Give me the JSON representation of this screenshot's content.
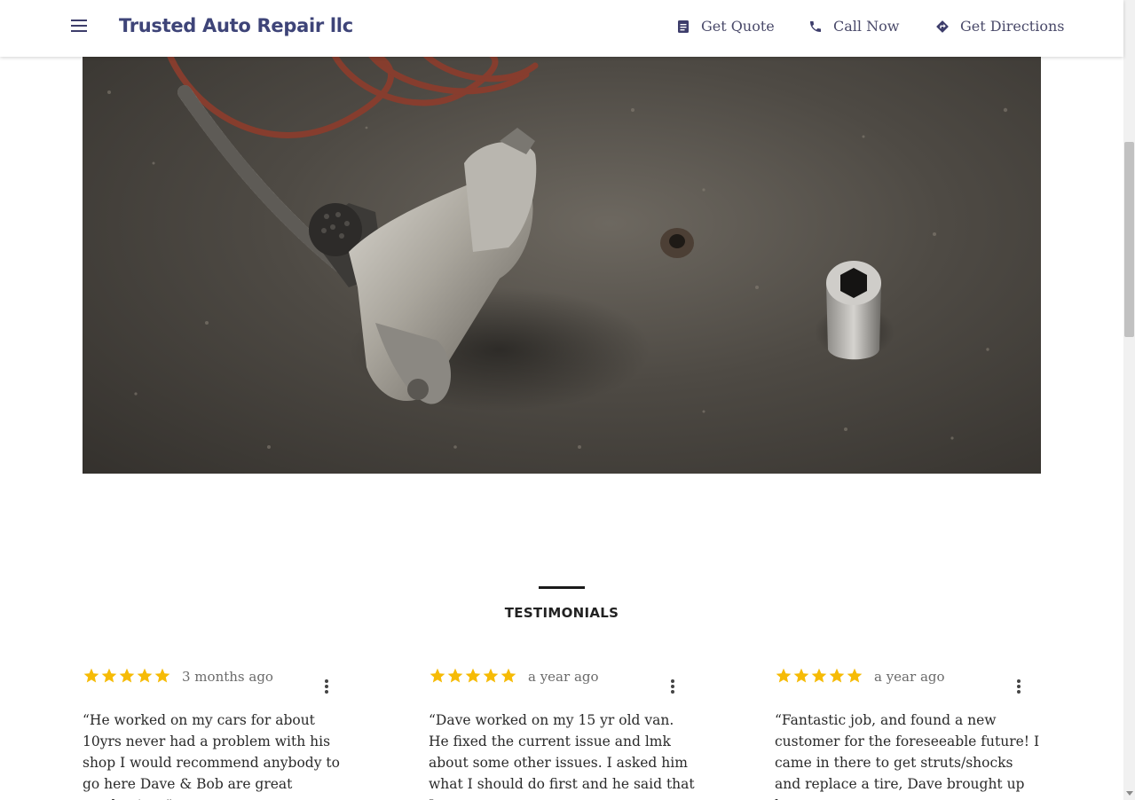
{
  "header": {
    "brand": "Trusted Auto Repair llc",
    "nav": {
      "quote": "Get Quote",
      "call": "Call Now",
      "directions": "Get Directions"
    }
  },
  "colors": {
    "brand": "#3e4478",
    "star": "#f6bb06",
    "text": "#212121"
  },
  "icons": {
    "menu": "menu-icon",
    "quote": "quote-doc-icon",
    "call": "phone-icon",
    "directions": "directions-icon",
    "star": "star-icon",
    "more": "more-vert-icon"
  },
  "hero": {
    "image": "impact wrench and sockets on concrete floor"
  },
  "testimonials": {
    "title": "TESTIMONIALS",
    "reviews": [
      {
        "rating": 5,
        "time": "3 months ago",
        "text": "“He worked on my cars for about 10yrs never had a problem with his shop I would recommend anybody to go here Dave & Bob are great mechanics..”"
      },
      {
        "rating": 5,
        "time": "a year ago",
        "text": "“Dave worked on my 15 yr old van. He fixed the current issue and lmk about some other issues. I asked him what I should do first and he said that I"
      },
      {
        "rating": 5,
        "time": "a year ago",
        "text": "“Fantastic job, and found a new customer for the foreseeable future! I came in there to get struts/shocks and replace a tire, Dave brought up how"
      }
    ]
  }
}
